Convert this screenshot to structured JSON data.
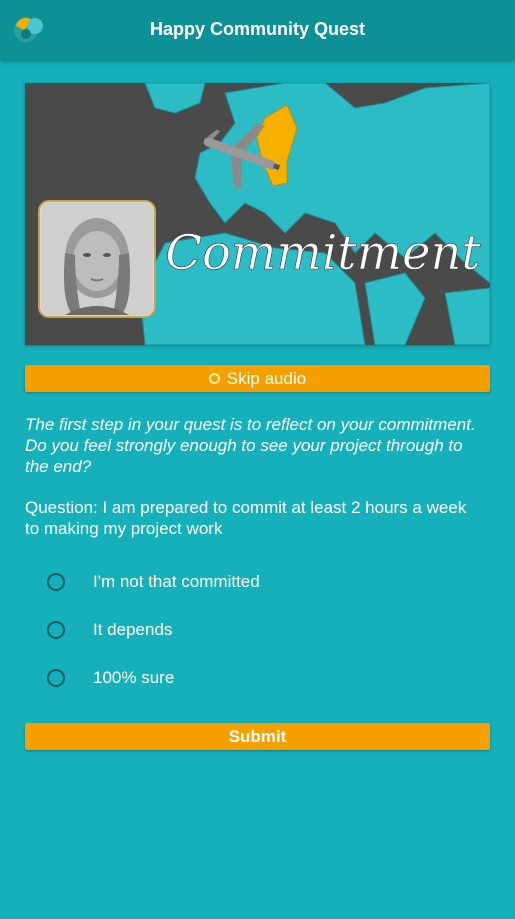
{
  "header": {
    "title": "Happy Community Quest"
  },
  "banner": {
    "caption": "Commitment"
  },
  "skip_audio": {
    "label": "Skip audio"
  },
  "intro_text": "The first step in your quest is to reflect on your commitment. Do you feel strongly enough to see your project through to the end?",
  "question_text": "Question: I am prepared to commit at least 2 hours a week to making my project work",
  "options": [
    {
      "label": "I'm not that committed",
      "selected": false
    },
    {
      "label": "It depends",
      "selected": false
    },
    {
      "label": "100% sure",
      "selected": false
    }
  ],
  "submit": {
    "label": "Submit"
  },
  "colors": {
    "background": "#15b0ba",
    "appbar": "#0e9097",
    "button": "#f6a000",
    "map_land": "#2bbcc6",
    "map_water": "#4a4a4a"
  }
}
